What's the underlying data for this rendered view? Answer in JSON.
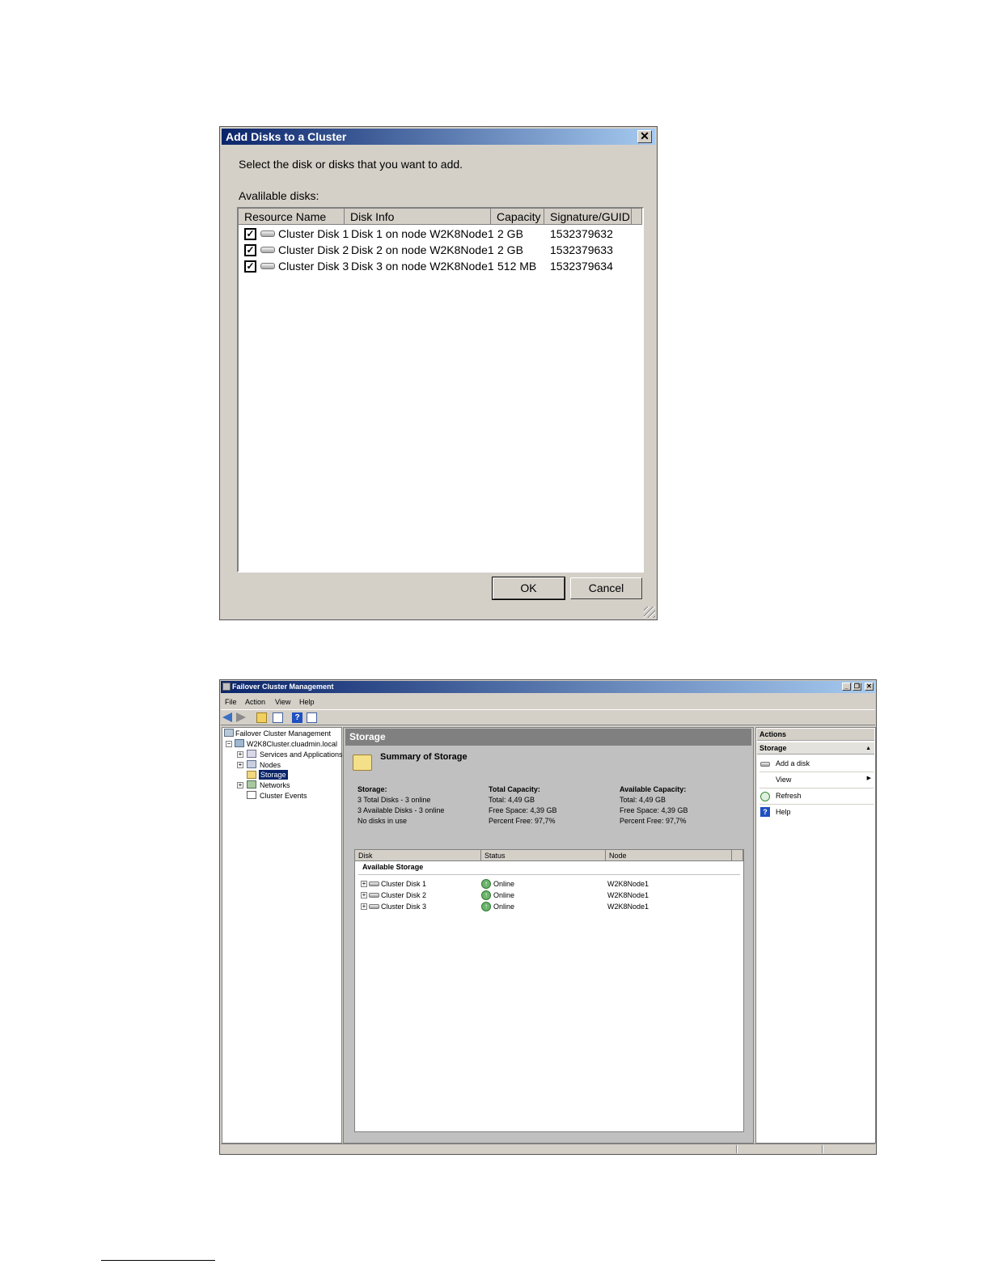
{
  "dialog": {
    "title": "Add Disks to a Cluster",
    "close_glyph": "✕",
    "instruction": "Select the disk or disks that you want to add.",
    "available_label": "Avalilable disks:",
    "columns": [
      "Resource Name",
      "Disk Info",
      "Capacity",
      "Signature/GUID"
    ],
    "rows": [
      {
        "checked": true,
        "name": "Cluster Disk 1",
        "info": "Disk 1 on node W2K8Node1",
        "capacity": "2 GB",
        "signature": "1532379632"
      },
      {
        "checked": true,
        "name": "Cluster Disk 2",
        "info": "Disk 2 on node W2K8Node1",
        "capacity": "2 GB",
        "signature": "1532379633"
      },
      {
        "checked": true,
        "name": "Cluster Disk 3",
        "info": "Disk 3 on node W2K8Node1",
        "capacity": "512 MB",
        "signature": "1532379634"
      }
    ],
    "ok_label": "OK",
    "cancel_label": "Cancel",
    "check_glyph": "✓"
  },
  "window": {
    "title": "Failover Cluster Management",
    "controls": {
      "minimize": "_",
      "restore": "❐",
      "close": "✕"
    },
    "menu": [
      "File",
      "Action",
      "View",
      "Help"
    ],
    "toolbar_icons": [
      "back-arrow-icon",
      "forward-arrow-icon",
      "up-folder-icon",
      "show-hide-console-tree-icon",
      "help-icon",
      "show-hide-action-pane-icon"
    ],
    "help_glyph": "?",
    "tree": {
      "root": "Failover Cluster Management",
      "cluster": "W2K8Cluster.cluadmin.local",
      "items": [
        "Services and Applications",
        "Nodes",
        "Storage",
        "Networks",
        "Cluster Events"
      ],
      "selected": "Storage",
      "expander_plus": "+",
      "expander_minus": "−"
    },
    "center": {
      "header": "Storage",
      "summary_title": "Summary of Storage",
      "stats": [
        {
          "heading": "Storage:",
          "lines": [
            "3 Total Disks - 3 online",
            "3 Available Disks - 3 online",
            "No disks in use"
          ]
        },
        {
          "heading": "Total Capacity:",
          "lines": [
            "Total: 4,49 GB",
            "Free Space: 4,39 GB",
            "Percent Free: 97,7%"
          ]
        },
        {
          "heading": "Available Capacity:",
          "lines": [
            "Total: 4,49 GB",
            "Free Space: 4,39 GB",
            "Percent Free: 97,7%"
          ]
        }
      ],
      "table_columns": [
        "Disk",
        "Status",
        "Node"
      ],
      "group": "Available Storage",
      "disks": [
        {
          "name": "Cluster Disk 1",
          "status": "Online",
          "node": "W2K8Node1"
        },
        {
          "name": "Cluster Disk 2",
          "status": "Online",
          "node": "W2K8Node1"
        },
        {
          "name": "Cluster Disk 3",
          "status": "Online",
          "node": "W2K8Node1"
        }
      ],
      "online_glyph": "↑"
    },
    "actions": {
      "header": "Actions",
      "section": "Storage",
      "collapse_glyph": "▲",
      "submenu_glyph": "▶",
      "items": [
        "Add a disk",
        "View",
        "Refresh",
        "Help"
      ]
    }
  },
  "colors": {
    "title_gradient_start": "#0a246a",
    "title_gradient_end": "#a6caf0",
    "window_face": "#d4d0c8",
    "online_green": "#6cb46c",
    "selection": "#0a246a"
  }
}
